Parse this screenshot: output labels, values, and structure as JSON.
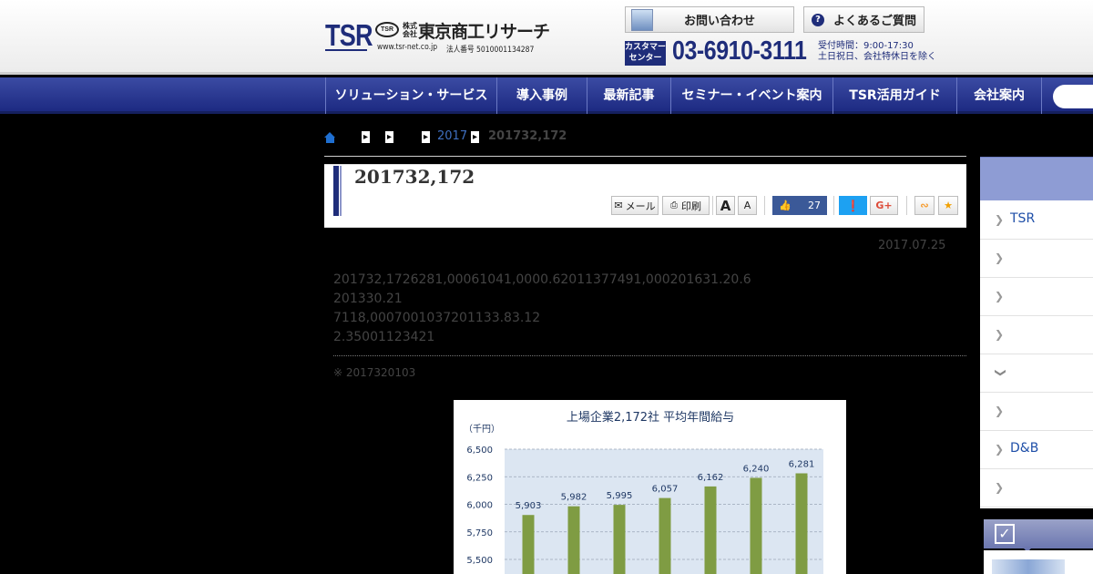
{
  "header": {
    "logo_text": "TSR",
    "logo_emblem": "TSR",
    "logo_kabushiki": "株式会社",
    "company_name": "東京商工リサーチ",
    "site_url": "www.tsr-net.co.jp",
    "corporate_number": "法人番号 5010001134287",
    "contact_label": "お問い合わせ",
    "faq_label": "よくあるご質問",
    "customer_center": "カスタマーセンター",
    "phone": "03-6910-3111",
    "hours_line1": "受付時間：9:00-17:30",
    "hours_line2": "土日祝日、会社特休日を除く"
  },
  "nav": {
    "items": [
      "ソリューション・サービス",
      "導入事例",
      "最新記事",
      "セミナー・イベント案内",
      "TSR活用ガイド",
      "会社案内"
    ]
  },
  "breadcrumb": {
    "year": "2017",
    "current": "201732,172"
  },
  "article": {
    "title": "201732,172",
    "date": "2017.07.25",
    "body_lines": [
      "201732,1726281,00061041,0000.62011377491,000201631.20.6",
      "201330.21",
      "7118,0007001037201133.83.12",
      "2.35001123421"
    ],
    "note": "※ 2017320103"
  },
  "toolbar": {
    "mail_label": "メール",
    "print_label": "印刷",
    "font_large": "A",
    "font_small": "A",
    "like_count": "27",
    "gplus_label": "G+"
  },
  "chart_data": {
    "type": "bar",
    "title": "上場企業2,172社 平均年間給与",
    "ylabel": "（千円）",
    "yticks": [
      5500,
      5750,
      6000,
      6250,
      6500
    ],
    "ytick_labels": [
      "5,500",
      "5,750",
      "6,000",
      "6,250",
      "6,500"
    ],
    "values": [
      5903,
      5982,
      5995,
      6057,
      6162,
      6240,
      6281
    ],
    "value_labels": [
      "5,903",
      "5,982",
      "5,995",
      "6,057",
      "6,162",
      "6,240",
      "6,281"
    ],
    "grid": true,
    "colors": {
      "bar": "#7f9c43",
      "plot_bg": "#dce6f2",
      "text": "#1f3864"
    }
  },
  "sidebar": {
    "items": [
      {
        "label": "TSR",
        "active": false
      },
      {
        "label": "",
        "active": false
      },
      {
        "label": "",
        "active": false
      },
      {
        "label": "",
        "active": false
      },
      {
        "label": "",
        "active": true
      },
      {
        "label": "",
        "active": false
      },
      {
        "label": "D&B",
        "active": false
      },
      {
        "label": "",
        "active": false
      }
    ],
    "widget_check": "✓"
  }
}
